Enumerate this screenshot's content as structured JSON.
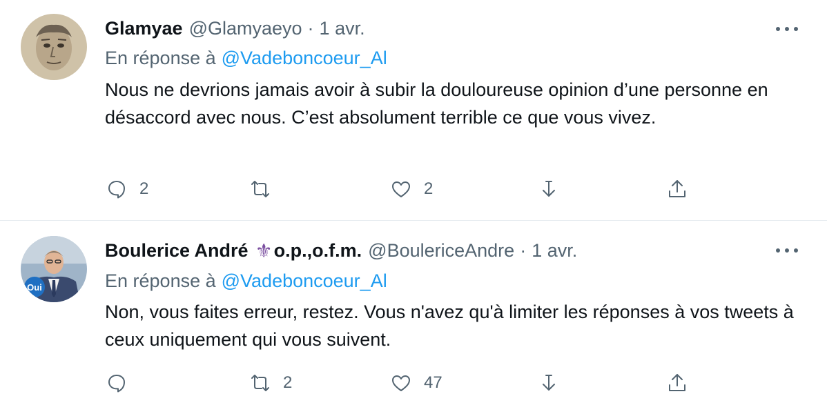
{
  "tweets": [
    {
      "name": "Glamyae",
      "handle": "@Glamyaeyo",
      "separator": "·",
      "date": "1 avr.",
      "reply_prefix": "En réponse à",
      "reply_mention": "@Vadeboncoeur_Al",
      "text": "Nous ne devrions jamais avoir à subir la douloureuse opinion d’une personne en désaccord avec nous. C’est absolument terrible ce que vous vivez.",
      "replies": "2",
      "retweets": "",
      "likes": "2",
      "icons": {
        "reply": "speech-bubble-icon",
        "retweet": "retweet-icon",
        "like": "heart-icon",
        "save": "download-arrow-icon",
        "share": "share-upload-icon"
      }
    },
    {
      "name": "Boulerice André",
      "name_suffix": "o.p.,o.f.m.",
      "handle": "@BoulericeAndre",
      "separator": "·",
      "date": "1 avr.",
      "reply_prefix": "En réponse à",
      "reply_mention": "@Vadeboncoeur_Al",
      "text": "Non, vous faites erreur, restez. Vous n'avez qu'à limiter les réponses à vos tweets à ceux uniquement qui vous suivent.",
      "replies": "",
      "retweets": "2",
      "likes": "47",
      "avatar_badge": "Oui",
      "icons": {
        "reply": "speech-bubble-icon",
        "retweet": "retweet-icon",
        "like": "heart-icon",
        "save": "download-arrow-icon",
        "share": "share-upload-icon"
      }
    }
  ],
  "colors": {
    "link": "#1d9bf0",
    "muted": "#536471",
    "text": "#0f1419",
    "divider": "#e6ecf0",
    "fleur_de_lis": "#7b4fa0"
  }
}
